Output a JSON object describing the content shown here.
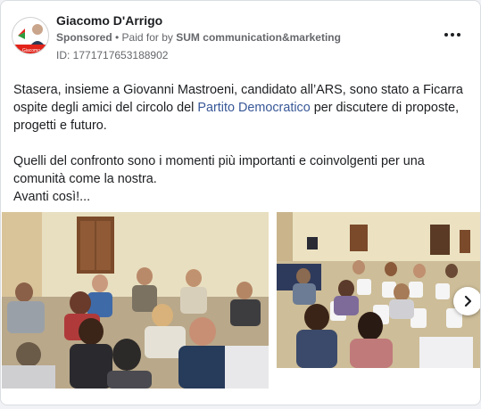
{
  "post": {
    "author": "Giacomo D'Arrigo",
    "sponsored_label": "Sponsored",
    "paid_for_prefix": "• Paid for by",
    "payer": "SUM communication&marketing",
    "id_text": "ID: 1771717653188902",
    "logo_text": "Giacomo",
    "body": {
      "p1_a": "Stasera, insieme a Giovanni Mastroeni, candidato all’ARS, sono stato a Ficarra ospite degli amici del circolo del ",
      "p1_link": "Partito Democratico",
      "p1_b": " per discutere di proposte, progetti e futuro.",
      "p2_line1": "Quelli del confronto sono i momenti più importanti e coinvolgenti per una comunità come la nostra.",
      "p2_line2": "Avanti così!..."
    }
  },
  "icons": {
    "more": "more-horizontal-icon",
    "next": "chevron-right-icon"
  },
  "colors": {
    "link": "#385898",
    "secondary_text": "#65676b",
    "brand_red": "#e2231a",
    "brand_green": "#2e9b3e"
  }
}
